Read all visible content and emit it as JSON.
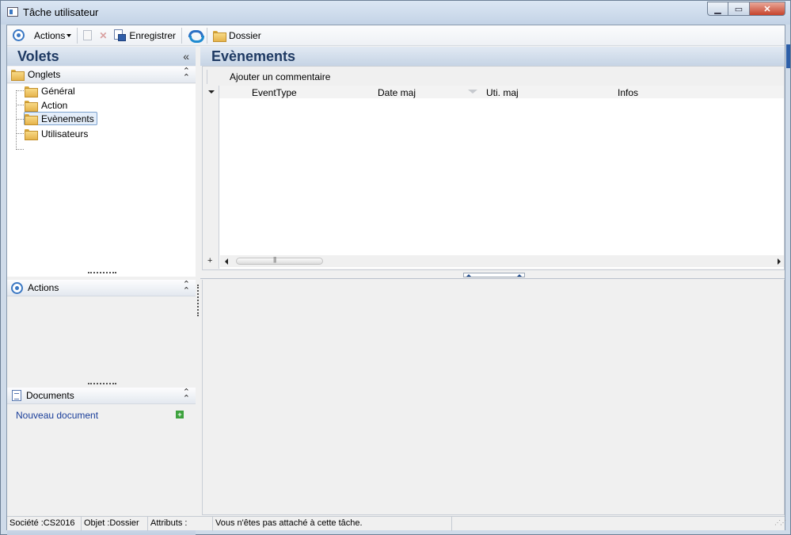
{
  "window": {
    "title": "Tâche utilisateur"
  },
  "toolbar": {
    "actions_label": "Actions",
    "save_label": "Enregistrer",
    "folder_label": "Dossier"
  },
  "left": {
    "title": "Volets",
    "collapse_glyph": "«",
    "onglets": {
      "label": "Onglets",
      "items": [
        {
          "label": "Général"
        },
        {
          "label": "Action"
        },
        {
          "label": "Evènements",
          "selected": true
        },
        {
          "label": "Utilisateurs"
        }
      ]
    },
    "actions": {
      "label": "Actions"
    },
    "documents": {
      "label": "Documents",
      "new_document": "Nouveau document"
    }
  },
  "main": {
    "title": "Evènements",
    "add_comment": "Ajouter un commentaire",
    "columns": [
      "EventType",
      "Date maj",
      "Uti. maj",
      "Infos"
    ]
  },
  "statusbar": {
    "company": "Société :CS2016",
    "object": "Objet :Dossier",
    "attributes": "Attributs :",
    "message": "Vous n'êtes pas attaché à cette tâche."
  },
  "colors": {
    "accent": "#3b78c3",
    "header_text": "#1f3a63",
    "link": "#1a3e9a"
  }
}
